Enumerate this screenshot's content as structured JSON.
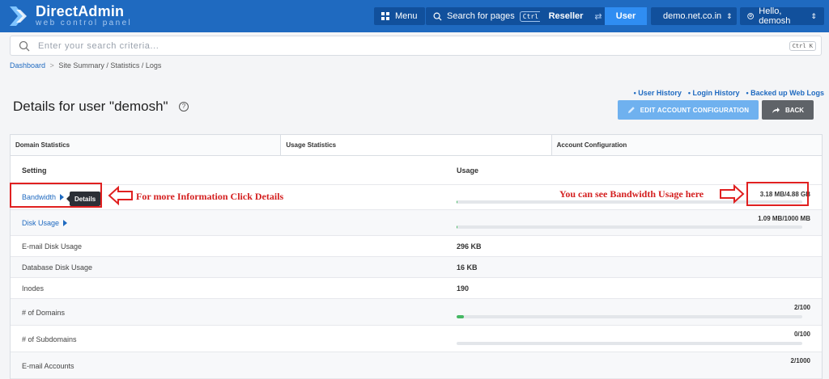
{
  "header": {
    "logo_title": "DirectAdmin",
    "logo_subtitle": "web control panel",
    "menu_label": "Menu",
    "search_pages_label": "Search for pages",
    "search_pages_shortcut": "Ctrl J",
    "role_left": "Reseller",
    "role_right": "User",
    "domain_label": "demo.net.co.in",
    "user_label": "Hello, demosh",
    "colors": {
      "header_bg": "#1f6ac0",
      "button_bg": "#11509c",
      "active_role": "#2f8df2"
    }
  },
  "search": {
    "placeholder": "Enter your search criteria...",
    "shortcut": "Ctrl K"
  },
  "breadcrumb": {
    "home": "Dashboard",
    "separator": ">",
    "current": "Site Summary / Statistics / Logs"
  },
  "page": {
    "title": "Details for user \"demosh\"",
    "links": [
      "• User History",
      "• Login History",
      "• Backed up Web Logs"
    ],
    "edit_button": "EDIT ACCOUNT CONFIGURATION",
    "back_button": "BACK"
  },
  "tabs": [
    {
      "label": "Domain Statistics"
    },
    {
      "label": "Usage Statistics"
    },
    {
      "label": "Account Configuration"
    }
  ],
  "table": {
    "headers": {
      "setting": "Setting",
      "usage": "Usage"
    },
    "rows": [
      {
        "label": "Bandwidth",
        "value": "3.18 MB/4.88 GB",
        "progress": 0.0007
      },
      {
        "label": "Disk Usage",
        "value": "1.09 MB/1000 MB",
        "progress": 0.001
      },
      {
        "label": "E-mail Disk Usage",
        "value": "296 KB"
      },
      {
        "label": "Database Disk Usage",
        "value": "16 KB"
      },
      {
        "label": "Inodes",
        "value": "190"
      },
      {
        "label": "# of Domains",
        "value": "2/100",
        "progress": 0.02
      },
      {
        "label": "# of Subdomains",
        "value": "0/100",
        "progress": 0
      },
      {
        "label": "E-mail Accounts",
        "value": "2/1000",
        "progress": 0.002
      }
    ],
    "tooltip": "Details"
  },
  "annotations": {
    "details_hint": "For more Information Click Details",
    "bandwidth_hint": "You can see Bandwidth Usage here",
    "color": "#e02020"
  }
}
